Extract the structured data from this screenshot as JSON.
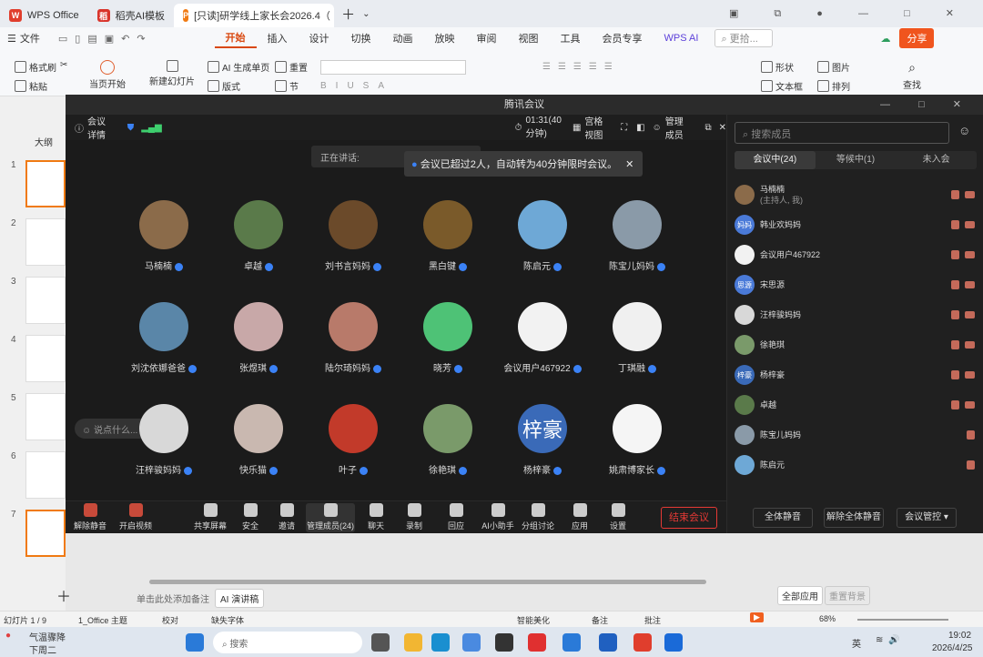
{
  "wps_tabs": [
    {
      "label": "WPS Office",
      "color": "#e03e2d",
      "logo": "W"
    },
    {
      "label": "稻壳AI模板",
      "color": "#d9342b",
      "logo": "稻"
    },
    {
      "label": "[只读]研学线上家长会2026.4（",
      "color": "#f07a12",
      "logo": "P"
    }
  ],
  "menu": {
    "file": "文件",
    "items": [
      "开始",
      "插入",
      "设计",
      "切换",
      "动画",
      "放映",
      "审阅",
      "视图",
      "工具",
      "会员专享"
    ],
    "wps_ai": "WPS AI",
    "search": "更拾...",
    "share": "分享"
  },
  "ribbon": {
    "format_painter": "格式刷",
    "paste": "粘贴",
    "play_current": "当页开始",
    "new_slide": "新建幻灯片",
    "ai_single": "AI 生成单页",
    "layout": "版式",
    "reset": "重置",
    "section": "节",
    "shape": "形状",
    "textbox": "文本框",
    "picture": "图片",
    "arrange": "排列",
    "find": "查找"
  },
  "left_pane": {
    "outline": "大纲",
    "slide_numbers": [
      "1",
      "2",
      "3",
      "4",
      "5",
      "6",
      "7"
    ]
  },
  "meeting": {
    "title": "腾讯会议",
    "details": "会议详情",
    "timer": "01:31(40分钟)",
    "grid_view": "宫格视图",
    "manage_members": "管理成员",
    "speaking": "正在讲话:",
    "notice": "会议已超过2人，自动转为40分钟限时会议。",
    "say_hint": "说点什么...",
    "participants": [
      {
        "name": "马楠楠",
        "color": "#8b6b4a",
        "text": ""
      },
      {
        "name": "卓越",
        "color": "#5a7a4a",
        "text": ""
      },
      {
        "name": "刘书言妈妈",
        "color": "#6b4a2a",
        "text": ""
      },
      {
        "name": "黑白键",
        "color": "#7a5a2a",
        "text": ""
      },
      {
        "name": "陈启元",
        "color": "#6ea8d6",
        "text": ""
      },
      {
        "name": "陈宝儿妈妈",
        "color": "#8a9aa8",
        "text": ""
      },
      {
        "name": "刘沈依娜爸爸",
        "color": "#5a86a8",
        "text": ""
      },
      {
        "name": "张煜琪",
        "color": "#c8a8a8",
        "text": ""
      },
      {
        "name": "陆尔琦妈妈",
        "color": "#b87a6a",
        "text": ""
      },
      {
        "name": "晓芳",
        "color": "#4ec276",
        "text": ""
      },
      {
        "name": "会议用户467922",
        "color": "#f2f2f2",
        "text": ""
      },
      {
        "name": "丁琪融",
        "color": "#f0f0f0",
        "text": ""
      },
      {
        "name": "汪梓骏妈妈",
        "color": "#d8d8d8",
        "text": ""
      },
      {
        "name": "快乐猫",
        "color": "#c9b8b0",
        "text": ""
      },
      {
        "name": "叶子",
        "color": "#c23a2a",
        "text": ""
      },
      {
        "name": "徐艳琪",
        "color": "#7a9a6a",
        "text": ""
      },
      {
        "name": "杨梓豪",
        "color": "#3a6ab8",
        "text": "梓豪"
      },
      {
        "name": "姚肃博家长",
        "color": "#f5f5f5",
        "text": ""
      }
    ],
    "toolbar": [
      {
        "label": "解除静音"
      },
      {
        "label": "开启视频"
      },
      {
        "label": "共享屏幕"
      },
      {
        "label": "安全"
      },
      {
        "label": "邀请"
      },
      {
        "label": "管理成员(24)"
      },
      {
        "label": "聊天"
      },
      {
        "label": "录制"
      },
      {
        "label": "回应"
      },
      {
        "label": "AI小助手"
      },
      {
        "label": "分组讨论"
      },
      {
        "label": "应用"
      },
      {
        "label": "设置"
      }
    ],
    "end_meeting": "结束会议"
  },
  "members_panel": {
    "title": "管理成员",
    "search_placeholder": "搜索成员",
    "tabs": [
      "会议中(24)",
      "等候中(1)",
      "未入会"
    ],
    "list": [
      {
        "name": "马楠楠",
        "sub": "(主持人, 我)",
        "color": "#8b6b4a",
        "text": ""
      },
      {
        "name": "韩业欢妈妈",
        "sub": "",
        "color": "#4a7ad8",
        "text": "妈妈"
      },
      {
        "name": "会议用户467922",
        "sub": "",
        "color": "#f2f2f2",
        "text": ""
      },
      {
        "name": "宋思源",
        "sub": "",
        "color": "#4a7ad8",
        "text": "思源"
      },
      {
        "name": "汪梓骏妈妈",
        "sub": "",
        "color": "#d8d8d8",
        "text": ""
      },
      {
        "name": "徐艳琪",
        "sub": "",
        "color": "#7a9a6a",
        "text": ""
      },
      {
        "name": "杨梓豪",
        "sub": "",
        "color": "#3a6ab8",
        "text": "梓豪"
      },
      {
        "name": "卓越",
        "sub": "",
        "color": "#5a7a4a",
        "text": ""
      },
      {
        "name": "陈宝儿妈妈",
        "sub": "",
        "color": "#8a9aa8",
        "text": ""
      },
      {
        "name": "陈启元",
        "sub": "",
        "color": "#6ea8d6",
        "text": ""
      }
    ],
    "mute_all": "全体静音",
    "unmute_all": "解除全体静音",
    "meeting_control": "会议管控"
  },
  "bottom": {
    "add_notes": "单击此处添加备注",
    "ai_speech": "AI 演讲稿",
    "apply_all": "全部应用",
    "reset_bg": "重置背景"
  },
  "statusbar": {
    "slide": "幻灯片 1 / 9",
    "theme": "1_Office 主题",
    "proof": "校对",
    "missing_font": "缺失字体",
    "beautify": "智能美化",
    "notes": "备注",
    "comment": "批注",
    "zoom": "68%"
  },
  "taskbar": {
    "weather_temp": "气温骤降",
    "weather_sub": "下周二",
    "search": "搜索",
    "ime": "英",
    "time": "19:02",
    "date": "2026/4/25"
  }
}
